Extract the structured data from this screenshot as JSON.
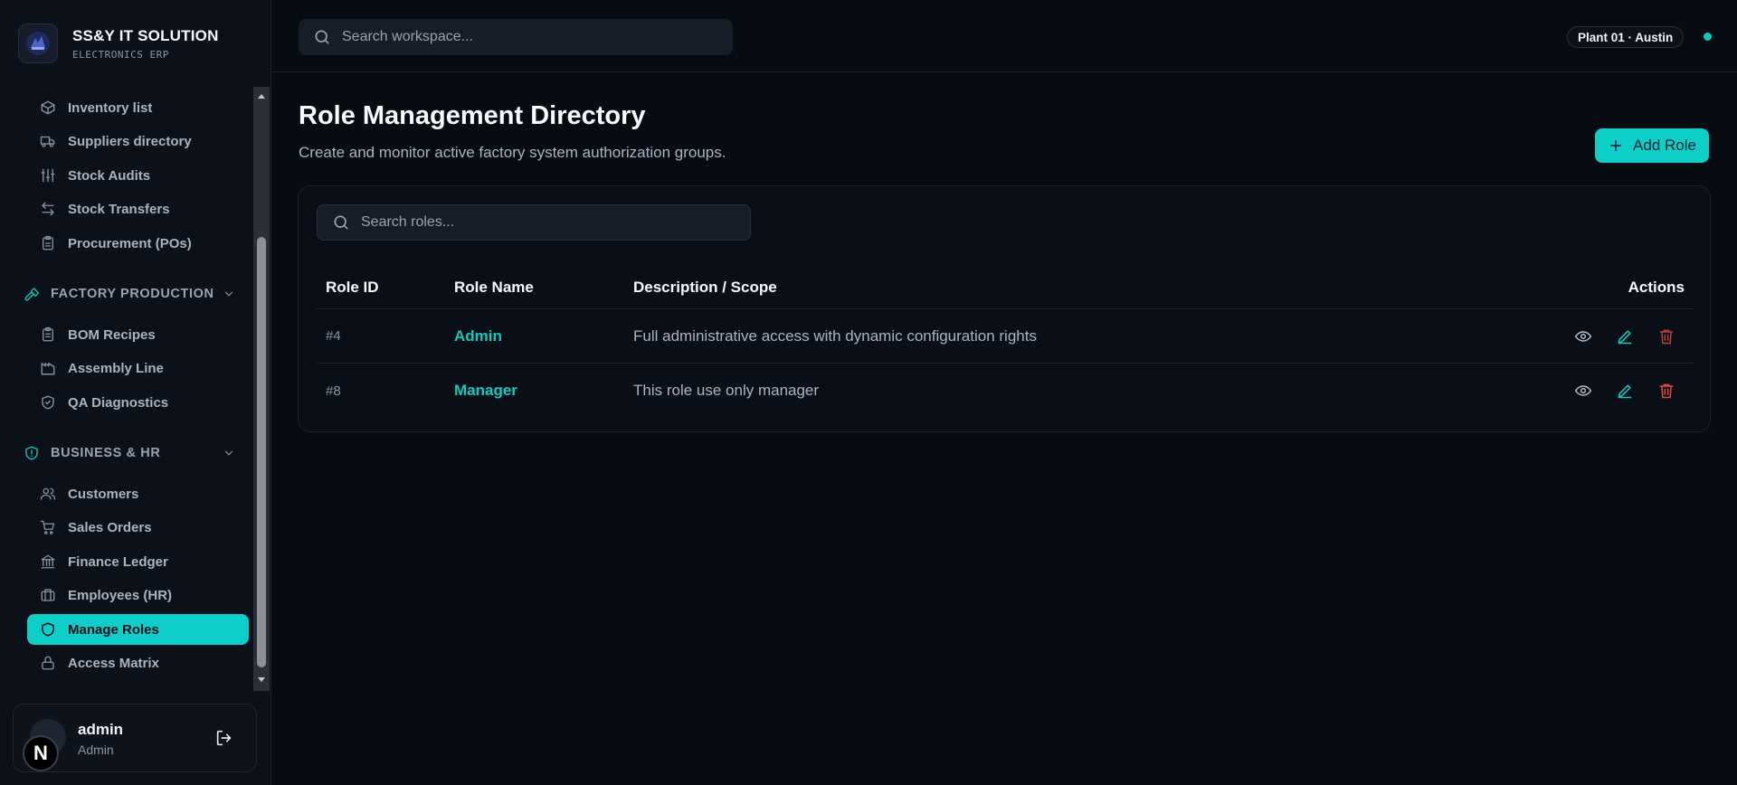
{
  "brand": {
    "title": "SS&Y IT SOLUTION",
    "subtitle": "ELECTRONICS ERP"
  },
  "sidebar": {
    "items_top": [
      {
        "label": "Inventory list",
        "icon": "package-icon"
      },
      {
        "label": "Suppliers directory",
        "icon": "truck-icon"
      },
      {
        "label": "Stock Audits",
        "icon": "sliders-icon"
      },
      {
        "label": "Stock Transfers",
        "icon": "arrows-left-right-icon"
      },
      {
        "label": "Procurement (POs)",
        "icon": "clipboard-icon"
      }
    ],
    "sections": [
      {
        "label": "FACTORY PRODUCTION",
        "icon": "hammer-icon",
        "items": [
          {
            "label": "BOM Recipes",
            "icon": "clipboard-list-icon"
          },
          {
            "label": "Assembly Line",
            "icon": "factory-icon"
          },
          {
            "label": "QA Diagnostics",
            "icon": "shield-check-icon"
          }
        ]
      },
      {
        "label": "BUSINESS & HR",
        "icon": "shield-alert-icon",
        "items": [
          {
            "label": "Customers",
            "icon": "users-icon"
          },
          {
            "label": "Sales Orders",
            "icon": "cart-icon"
          },
          {
            "label": "Finance Ledger",
            "icon": "bank-icon"
          },
          {
            "label": "Employees (HR)",
            "icon": "briefcase-icon"
          },
          {
            "label": "Manage Roles",
            "icon": "shield-icon",
            "active": true
          },
          {
            "label": "Access Matrix",
            "icon": "lock-icon"
          }
        ]
      }
    ]
  },
  "user": {
    "name": "admin",
    "role": "Admin",
    "badge_letter": "N"
  },
  "topbar": {
    "search_placeholder": "Search workspace...",
    "plant": "Plant 01 · Austin",
    "status_color": "#14c7c0"
  },
  "main": {
    "title": "Role Management Directory",
    "subtitle": "Create and monitor active factory system authorization groups.",
    "add_button": "Add Role",
    "search_placeholder": "Search roles...",
    "table": {
      "headers": {
        "id": "Role ID",
        "name": "Role Name",
        "desc": "Description / Scope",
        "actions": "Actions"
      },
      "rows": [
        {
          "id": "#4",
          "name": "Admin",
          "desc": "Full administrative access with dynamic configuration rights"
        },
        {
          "id": "#8",
          "name": "Manager",
          "desc": "This role use only manager"
        }
      ]
    }
  },
  "colors": {
    "accent": "#0dcfc8",
    "danger": "#ef4444",
    "background": "#070b12"
  }
}
